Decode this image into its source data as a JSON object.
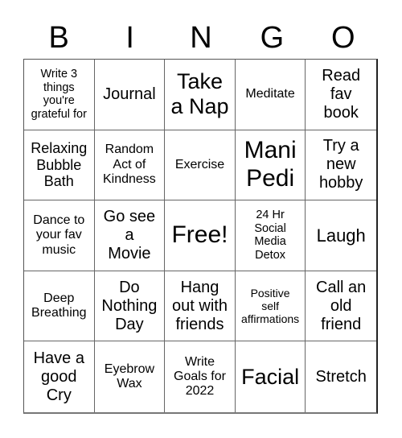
{
  "header": {
    "letters": [
      "B",
      "I",
      "N",
      "G",
      "O"
    ]
  },
  "grid": {
    "rows": [
      [
        "Write 3\nthings\nyou're\ngrateful for",
        "Journal",
        "Take\na Nap",
        "Meditate",
        "Read\nfav\nbook"
      ],
      [
        "Relaxing\nBubble\nBath",
        "Random\nAct of\nKindness",
        "Exercise",
        "Mani\nPedi",
        "Try a\nnew\nhobby"
      ],
      [
        "Dance to\nyour fav\nmusic",
        "Go see\na\nMovie",
        "Free!",
        "24 Hr\nSocial\nMedia\nDetox",
        "Laugh"
      ],
      [
        "Deep\nBreathing",
        "Do\nNothing\nDay",
        "Hang\nout with\nfriends",
        "Positive\nself\naffirmations",
        "Call an\nold\nfriend"
      ],
      [
        "Have a\ngood\nCry",
        "Eyebrow\nWax",
        "Write\nGoals for\n2022",
        "Facial",
        "Stretch"
      ]
    ]
  }
}
